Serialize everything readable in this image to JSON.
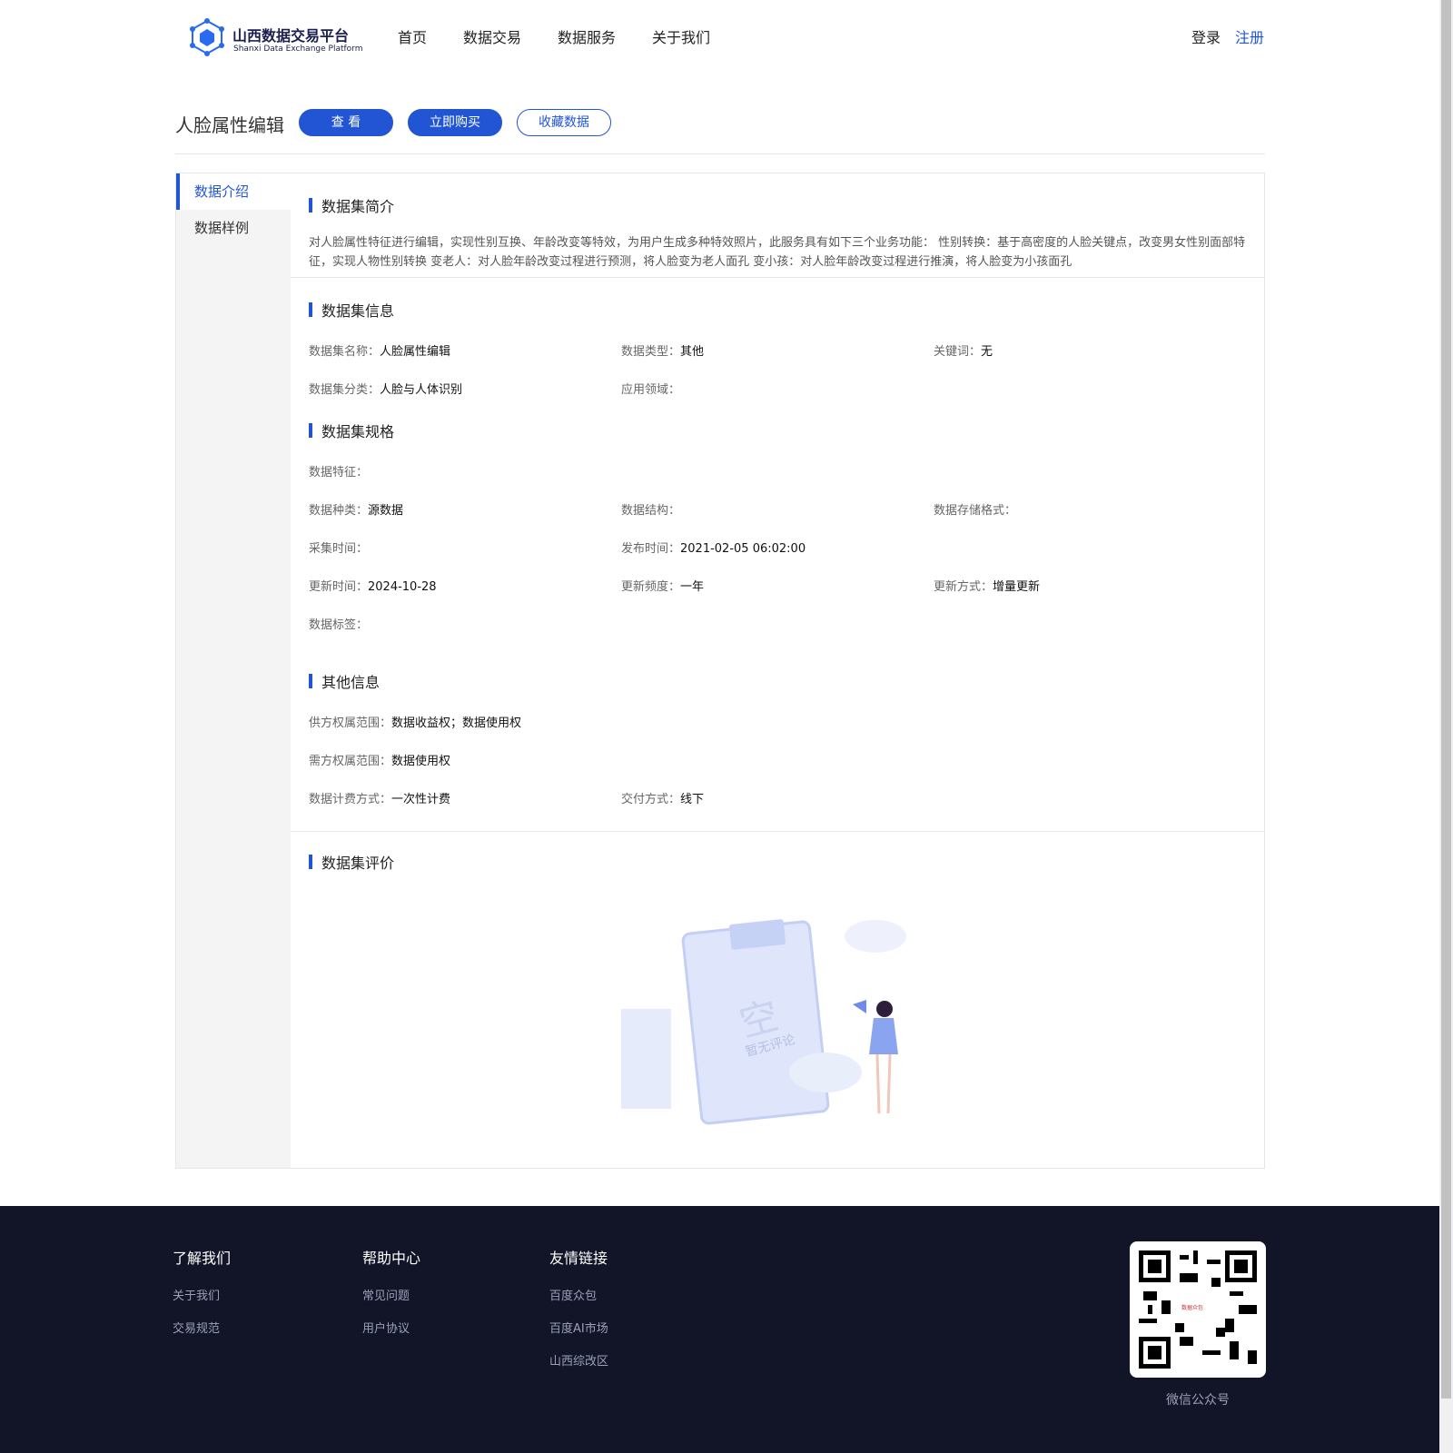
{
  "header": {
    "logo_title": "山西数据交易平台",
    "logo_subtitle": "Shanxi Data Exchange Platform",
    "nav": [
      "首页",
      "数据交易",
      "数据服务",
      "关于我们"
    ],
    "login": "登录",
    "register": "注册"
  },
  "dataset": {
    "title": "人脸属性编辑",
    "btn_view": "查 看",
    "btn_buy": "立即购买",
    "btn_fav": "收藏数据"
  },
  "sidebar": [
    "数据介绍",
    "数据样例"
  ],
  "intro": {
    "heading": "数据集简介",
    "text": "对人脸属性特征进行编辑，实现性别互换、年龄改变等特效，为用户生成多种特效照片，此服务具有如下三个业务功能： 性别转换：基于高密度的人脸关键点，改变男女性别面部特征，实现人物性别转换 变老人：对人脸年龄改变过程进行预测，将人脸变为老人面孔 变小孩：对人脸年龄改变过程进行推演，将人脸变为小孩面孔"
  },
  "info": {
    "heading": "数据集信息",
    "fields": [
      {
        "label": "数据集名称：",
        "value": "人脸属性编辑"
      },
      {
        "label": "数据类型：",
        "value": "其他"
      },
      {
        "label": "关键词：",
        "value": "无"
      },
      {
        "label": "数据集分类：",
        "value": "人脸与人体识别"
      },
      {
        "label": "应用领域：",
        "value": ""
      }
    ]
  },
  "spec": {
    "heading": "数据集规格",
    "fields": [
      {
        "label": "数据特征：",
        "value": ""
      },
      {
        "label": "数据种类：",
        "value": "源数据"
      },
      {
        "label": "数据结构：",
        "value": ""
      },
      {
        "label": "数据存储格式：",
        "value": ""
      },
      {
        "label": "采集时间：",
        "value": ""
      },
      {
        "label": "发布时间：",
        "value": "2021-02-05 06:02:00"
      },
      {
        "label": "更新时间：",
        "value": "2024-10-28"
      },
      {
        "label": "更新频度：",
        "value": "一年"
      },
      {
        "label": "更新方式：",
        "value": "增量更新"
      },
      {
        "label": "数据标签：",
        "value": ""
      }
    ]
  },
  "other": {
    "heading": "其他信息",
    "fields": [
      {
        "label": "供方权属范围：",
        "value": "数据收益权；数据使用权"
      },
      {
        "label": "需方权属范围：",
        "value": "数据使用权"
      },
      {
        "label": "数据计费方式：",
        "value": "一次性计费"
      },
      {
        "label": "交付方式：",
        "value": "线下"
      }
    ]
  },
  "review": {
    "heading": "数据集评价",
    "empty_big": "空",
    "empty_text": "暂无评论"
  },
  "footer": {
    "col1": {
      "title": "了解我们",
      "links": [
        "关于我们",
        "交易规范"
      ]
    },
    "col2": {
      "title": "帮助中心",
      "links": [
        "常见问题",
        "用户协议"
      ]
    },
    "col3": {
      "title": "友情链接",
      "links": [
        "百度众包",
        "百度AI市场",
        "山西综改区"
      ]
    },
    "qr_label": "微信公众号",
    "qr_logo_text": "数据众包"
  },
  "colors": {
    "accent": "#2255d3",
    "footer_bg": "#121528"
  }
}
